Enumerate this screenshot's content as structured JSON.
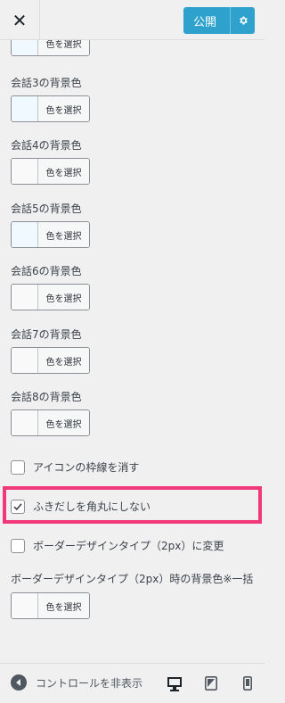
{
  "header": {
    "close_label": "✕",
    "publish_label": "公開",
    "settings_icon": "gear-icon"
  },
  "colors": {
    "accent": "#2ea2cc",
    "highlight": "#f1387a",
    "swatch": "#f0f9ff"
  },
  "color_controls": [
    {
      "label": "",
      "button": "色を選択"
    },
    {
      "label": "会話3の背景色",
      "button": "色を選択"
    },
    {
      "label": "会話4の背景色",
      "button": "色を選択"
    },
    {
      "label": "会話5の背景色",
      "button": "色を選択"
    },
    {
      "label": "会話6の背景色",
      "button": "色を選択"
    },
    {
      "label": "会話7の背景色",
      "button": "色を選択"
    },
    {
      "label": "会話8の背景色",
      "button": "色を選択"
    }
  ],
  "checkboxes": [
    {
      "label": "アイコンの枠線を消す",
      "checked": false
    },
    {
      "label": "ふきだしを角丸にしない",
      "checked": true
    },
    {
      "label": "ボーダーデザインタイプ（2px）に変更",
      "checked": false
    }
  ],
  "border_bg": {
    "label": "ボーダーデザインタイプ（2px）時の背景色※一括",
    "button": "色を選択"
  },
  "footer": {
    "collapse_label": "コントロールを非表示",
    "devices": [
      "desktop-icon",
      "tablet-icon",
      "mobile-icon"
    ]
  }
}
